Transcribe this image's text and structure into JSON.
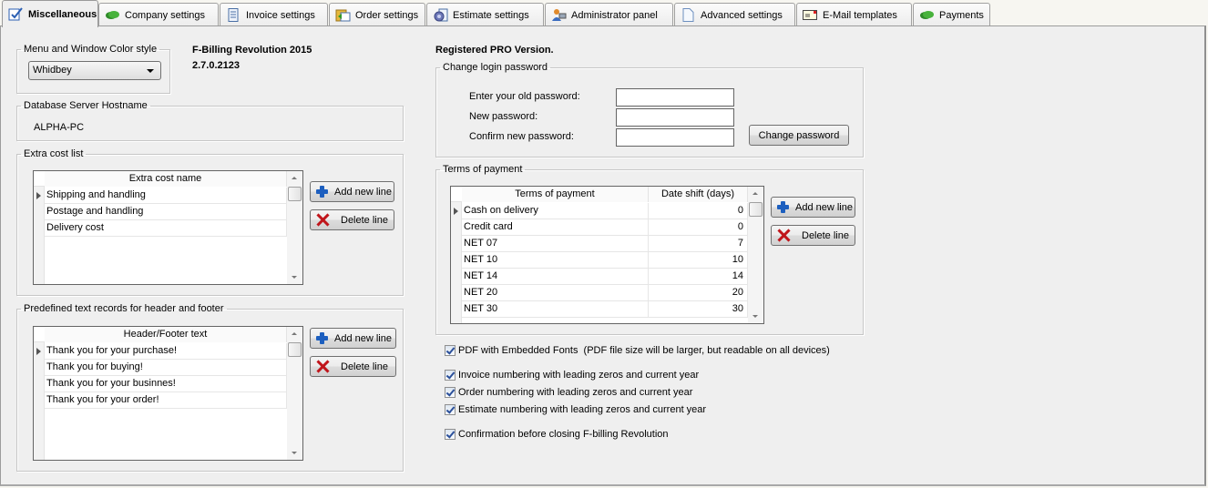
{
  "tabs": [
    {
      "label": "Miscellaneous",
      "icon": "misc-settings-icon",
      "active": true
    },
    {
      "label": "Company settings",
      "icon": "money-icon",
      "active": false
    },
    {
      "label": "Invoice settings",
      "icon": "invoice-document-icon",
      "active": false
    },
    {
      "label": "Order settings",
      "icon": "order-icon",
      "active": false
    },
    {
      "label": "Estimate settings",
      "icon": "estimate-icon",
      "active": false
    },
    {
      "label": "Administrator panel",
      "icon": "administrator-icon",
      "active": false
    },
    {
      "label": "Advanced settings",
      "icon": "blank-document-icon",
      "active": false
    },
    {
      "label": "E-Mail templates",
      "icon": "email-template-icon",
      "active": false
    },
    {
      "label": "Payments",
      "icon": "money-icon",
      "active": false
    }
  ],
  "color_style": {
    "legend": "Menu and Window Color style",
    "selected": "Whidbey"
  },
  "app_info": {
    "name": "F-Billing Revolution 2015",
    "version": "2.7.0.2123",
    "registration": "Registered PRO Version."
  },
  "db_server": {
    "legend": "Database Server Hostname",
    "value": "ALPHA-PC"
  },
  "extra_cost": {
    "legend": "Extra cost list",
    "column": "Extra cost name",
    "rows": [
      "Shipping and handling",
      "Postage and handling",
      "Delivery cost"
    ],
    "add_label": "Add new line",
    "delete_label": "Delete line"
  },
  "header_footer": {
    "legend": "Predefined text records for header and footer",
    "column": "Header/Footer text",
    "rows": [
      "Thank you for your purchase!",
      "Thank you for buying!",
      "Thank you for your businnes!",
      "Thank you for your order!"
    ],
    "add_label": "Add new line",
    "delete_label": "Delete line"
  },
  "password": {
    "legend": "Change login password",
    "old_label": "Enter your old password:",
    "old_value": "",
    "new_label": "New password:",
    "new_value": "",
    "confirm_label": "Confirm new password:",
    "confirm_value": "",
    "button": "Change password"
  },
  "terms": {
    "legend": "Terms of payment",
    "columns": [
      "Terms of payment",
      "Date shift (days)"
    ],
    "rows": [
      {
        "term": "Cash on delivery",
        "days": "0"
      },
      {
        "term": "Credit card",
        "days": "0"
      },
      {
        "term": "NET 07",
        "days": "7"
      },
      {
        "term": "NET 10",
        "days": "10"
      },
      {
        "term": "NET 14",
        "days": "14"
      },
      {
        "term": "NET 20",
        "days": "20"
      },
      {
        "term": "NET 30",
        "days": "30"
      }
    ],
    "add_label": "Add new line",
    "delete_label": "Delete line"
  },
  "options": [
    {
      "label": "PDF with Embedded Fonts  (PDF file size will be larger, but readable on all devices)",
      "checked": true
    },
    {
      "label": "Invoice numbering with leading zeros and current year",
      "checked": true
    },
    {
      "label": "Order numbering with leading zeros and current year",
      "checked": true
    },
    {
      "label": "Estimate numbering with leading zeros and current year",
      "checked": true
    },
    {
      "label": "Confirmation before closing F-billing Revolution",
      "checked": true
    }
  ]
}
